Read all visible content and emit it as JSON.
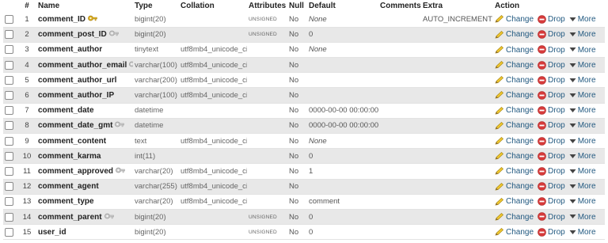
{
  "headers": {
    "num": "#",
    "name": "Name",
    "type": "Type",
    "collation": "Collation",
    "attributes": "Attributes",
    "null": "Null",
    "default": "Default",
    "comments": "Comments",
    "extra": "Extra",
    "action": "Action"
  },
  "actions": {
    "change": "Change",
    "drop": "Drop",
    "more": "More"
  },
  "rows": [
    {
      "num": "1",
      "name": "comment_ID",
      "key": "primary",
      "type": "bigint(20)",
      "collation": "",
      "attributes": "UNSIGNED",
      "null": "No",
      "default": "None",
      "default_italic": true,
      "comments": "",
      "extra": "AUTO_INCREMENT"
    },
    {
      "num": "2",
      "name": "comment_post_ID",
      "key": "index",
      "type": "bigint(20)",
      "collation": "",
      "attributes": "UNSIGNED",
      "null": "No",
      "default": "0",
      "default_italic": false,
      "comments": "",
      "extra": ""
    },
    {
      "num": "3",
      "name": "comment_author",
      "key": "",
      "type": "tinytext",
      "collation": "utf8mb4_unicode_ci",
      "attributes": "",
      "null": "No",
      "default": "None",
      "default_italic": true,
      "comments": "",
      "extra": ""
    },
    {
      "num": "4",
      "name": "comment_author_email",
      "key": "index",
      "type": "varchar(100)",
      "collation": "utf8mb4_unicode_ci",
      "attributes": "",
      "null": "No",
      "default": "",
      "default_italic": false,
      "comments": "",
      "extra": ""
    },
    {
      "num": "5",
      "name": "comment_author_url",
      "key": "",
      "type": "varchar(200)",
      "collation": "utf8mb4_unicode_ci",
      "attributes": "",
      "null": "No",
      "default": "",
      "default_italic": false,
      "comments": "",
      "extra": ""
    },
    {
      "num": "6",
      "name": "comment_author_IP",
      "key": "",
      "type": "varchar(100)",
      "collation": "utf8mb4_unicode_ci",
      "attributes": "",
      "null": "No",
      "default": "",
      "default_italic": false,
      "comments": "",
      "extra": ""
    },
    {
      "num": "7",
      "name": "comment_date",
      "key": "",
      "type": "datetime",
      "collation": "",
      "attributes": "",
      "null": "No",
      "default": "0000-00-00 00:00:00",
      "default_italic": false,
      "comments": "",
      "extra": ""
    },
    {
      "num": "8",
      "name": "comment_date_gmt",
      "key": "index",
      "type": "datetime",
      "collation": "",
      "attributes": "",
      "null": "No",
      "default": "0000-00-00 00:00:00",
      "default_italic": false,
      "comments": "",
      "extra": ""
    },
    {
      "num": "9",
      "name": "comment_content",
      "key": "",
      "type": "text",
      "collation": "utf8mb4_unicode_ci",
      "attributes": "",
      "null": "No",
      "default": "None",
      "default_italic": true,
      "comments": "",
      "extra": ""
    },
    {
      "num": "10",
      "name": "comment_karma",
      "key": "",
      "type": "int(11)",
      "collation": "",
      "attributes": "",
      "null": "No",
      "default": "0",
      "default_italic": false,
      "comments": "",
      "extra": ""
    },
    {
      "num": "11",
      "name": "comment_approved",
      "key": "index",
      "type": "varchar(20)",
      "collation": "utf8mb4_unicode_ci",
      "attributes": "",
      "null": "No",
      "default": "1",
      "default_italic": false,
      "comments": "",
      "extra": ""
    },
    {
      "num": "12",
      "name": "comment_agent",
      "key": "",
      "type": "varchar(255)",
      "collation": "utf8mb4_unicode_ci",
      "attributes": "",
      "null": "No",
      "default": "",
      "default_italic": false,
      "comments": "",
      "extra": ""
    },
    {
      "num": "13",
      "name": "comment_type",
      "key": "",
      "type": "varchar(20)",
      "collation": "utf8mb4_unicode_ci",
      "attributes": "",
      "null": "No",
      "default": "comment",
      "default_italic": false,
      "comments": "",
      "extra": ""
    },
    {
      "num": "14",
      "name": "comment_parent",
      "key": "index",
      "type": "bigint(20)",
      "collation": "",
      "attributes": "UNSIGNED",
      "null": "No",
      "default": "0",
      "default_italic": false,
      "comments": "",
      "extra": ""
    },
    {
      "num": "15",
      "name": "user_id",
      "key": "",
      "type": "bigint(20)",
      "collation": "",
      "attributes": "UNSIGNED",
      "null": "No",
      "default": "0",
      "default_italic": false,
      "comments": "",
      "extra": ""
    }
  ],
  "colors": {
    "link": "#235a81",
    "row_alt": "#e8e8e8",
    "drop": "#d63a3a",
    "key": "#e0b422"
  }
}
